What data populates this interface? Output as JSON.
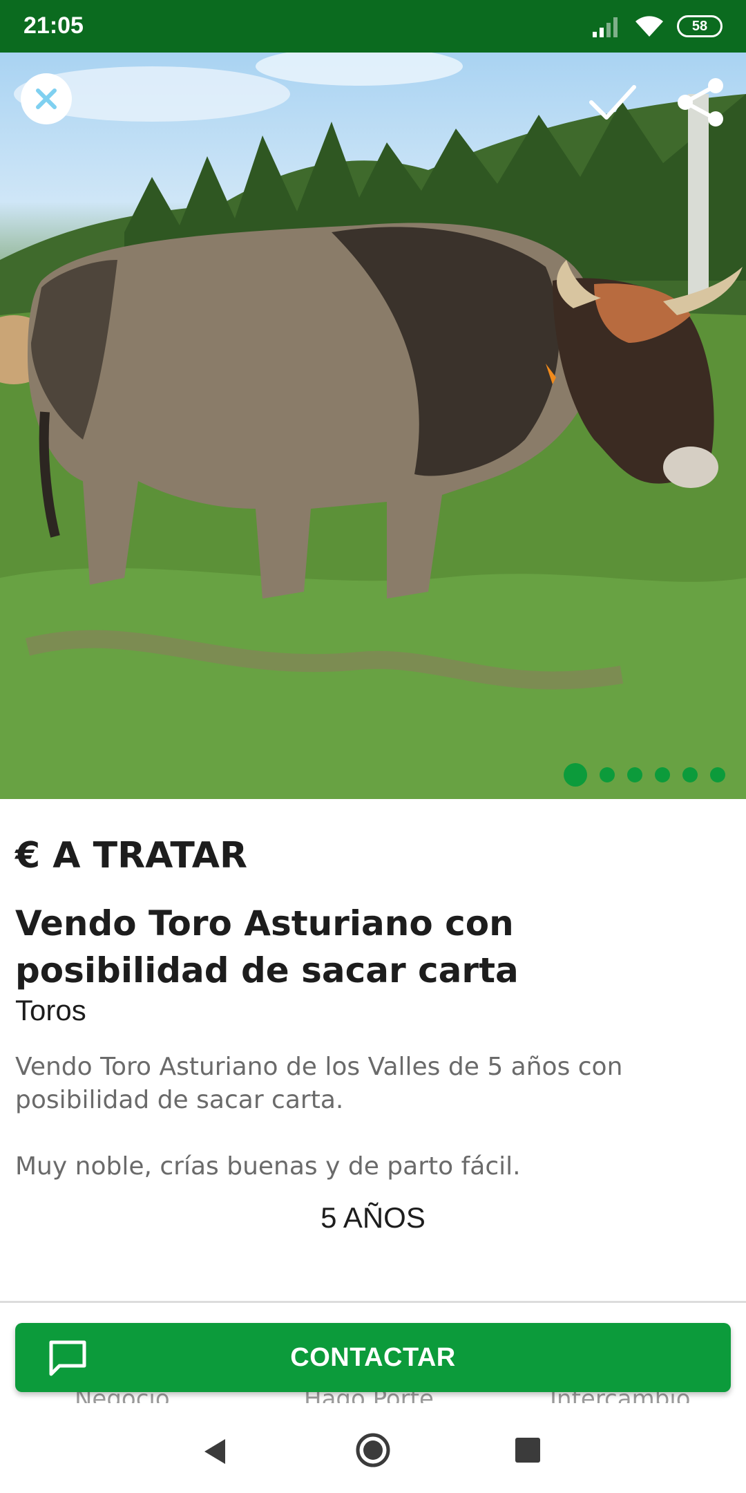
{
  "status_bar": {
    "time": "21:05",
    "battery": "58",
    "icons": [
      "signal-icon",
      "wifi-icon",
      "battery-icon"
    ]
  },
  "photo": {
    "carousel_count": 6,
    "carousel_active": 1,
    "buttons": [
      "close-icon",
      "check-icon",
      "share-icon"
    ]
  },
  "listing": {
    "price": "€ A TRATAR",
    "title": "Vendo Toro Asturiano con posibilidad de sacar carta",
    "category": "Toros",
    "description_1": "Vendo Toro Asturiano de los Valles de 5 años con posibilidad de sacar carta.",
    "description_2": "Muy noble, crías buenas y de parto fácil.",
    "age": "5 AÑOS"
  },
  "tags": [
    "Negocio",
    "Hago Porte",
    "Intercambio"
  ],
  "contact": {
    "label": "CONTACTAR",
    "icon": "chat-icon"
  },
  "colors": {
    "status_bar": "#0b6b1f",
    "accent": "#0c9b3b"
  },
  "navigation": [
    "back-icon",
    "home-icon",
    "recents-icon"
  ]
}
